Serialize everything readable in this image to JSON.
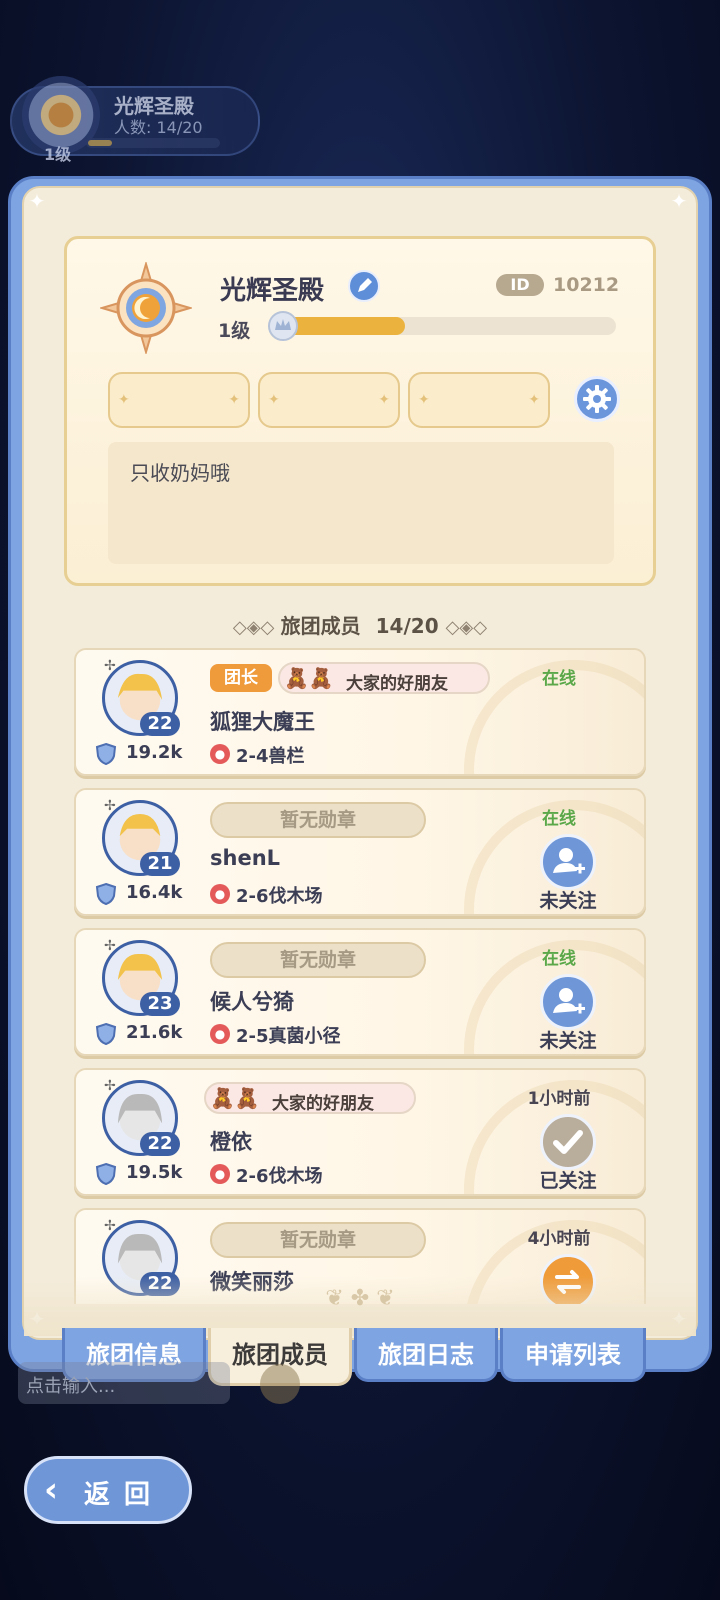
{
  "hud": {
    "guild_name": "光辉圣殿",
    "member_count": "人数: 14/20",
    "level": "1级"
  },
  "guild": {
    "name": "光辉圣殿",
    "id_label": "ID",
    "id_value": "10212",
    "level": "1级",
    "level_progress": 0.36,
    "motto": "只收奶妈哦"
  },
  "members_header": {
    "title": "旅团成员",
    "count": "14/20"
  },
  "members": [
    {
      "level": "22",
      "role": "团长",
      "badge": "大家的好朋友",
      "name": "狐狸大魔王",
      "power": "19.2k",
      "stage": "2-4兽栏",
      "status": "在线",
      "status_type": "online",
      "follow": ""
    },
    {
      "level": "21",
      "role": "",
      "badge": "暂无勋章",
      "name": "shenL",
      "power": "16.4k",
      "stage": "2-6伐木场",
      "status": "在线",
      "status_type": "online",
      "follow": "未关注"
    },
    {
      "level": "23",
      "role": "",
      "badge": "暂无勋章",
      "name": "候人兮猗",
      "power": "21.6k",
      "stage": "2-5真菌小径",
      "status": "在线",
      "status_type": "online",
      "follow": "未关注"
    },
    {
      "level": "22",
      "role": "",
      "badge": "大家的好朋友",
      "name": "橙依",
      "power": "19.5k",
      "stage": "2-6伐木场",
      "status": "1小时前",
      "status_type": "offline",
      "follow": "已关注"
    },
    {
      "level": "22",
      "role": "",
      "badge": "暂无勋章",
      "name": "微笑丽莎",
      "power": "",
      "stage": "",
      "status": "4小时前",
      "status_type": "offline",
      "follow": ""
    }
  ],
  "tabs": [
    {
      "label": "旅团信息",
      "active": false
    },
    {
      "label": "旅团成员",
      "active": true
    },
    {
      "label": "旅团日志",
      "active": false
    },
    {
      "label": "申请列表",
      "active": false
    }
  ],
  "chat": {
    "placeholder": "点击输入..."
  },
  "back": {
    "label": "返回"
  },
  "colors": {
    "panel_blue": "#7ea4e2",
    "online_green": "#5aa84a",
    "progress_gold": "#ebb33d",
    "leader_orange": "#f09b3b"
  }
}
